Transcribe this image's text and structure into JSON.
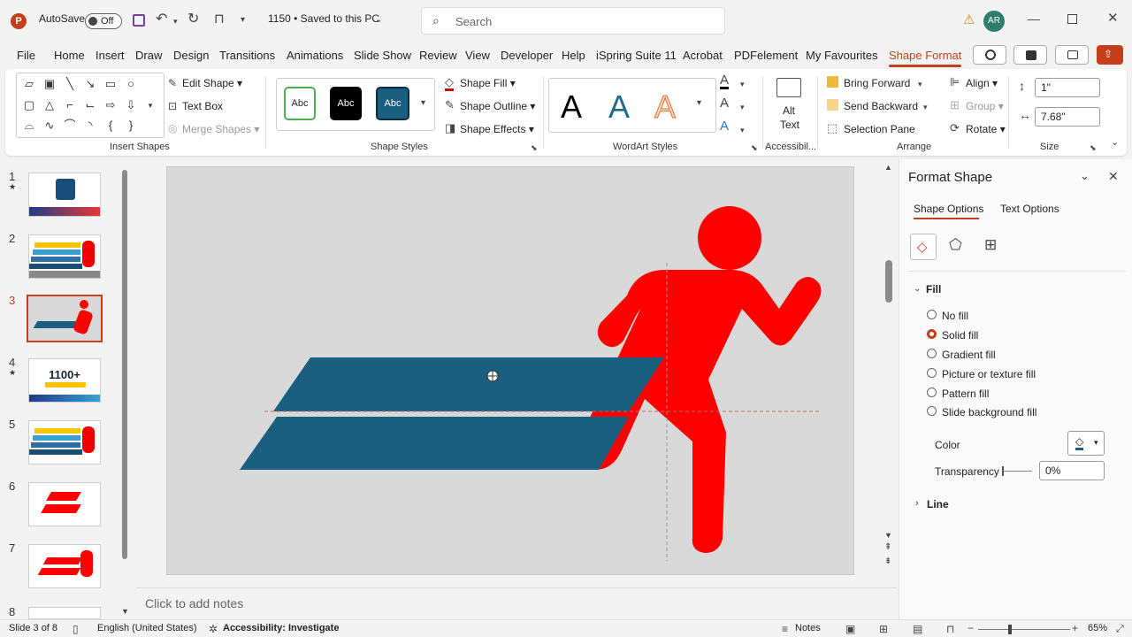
{
  "titlebar": {
    "app_icon_letter": "P",
    "autosave_label": "AutoSave",
    "autosave_state": "Off",
    "doc_title": "1150 • Saved to this PC",
    "search_placeholder": "Search",
    "avatar_initials": "AR"
  },
  "menu": {
    "tabs": [
      "File",
      "Home",
      "Insert",
      "Draw",
      "Design",
      "Transitions",
      "Animations",
      "Slide Show",
      "Review",
      "View",
      "Developer",
      "Help",
      "iSpring Suite 11",
      "Acrobat",
      "PDFelement",
      "My Favourites",
      "Shape Format"
    ],
    "active_tab": "Shape Format"
  },
  "ribbon": {
    "insert_shapes": {
      "group_label": "Insert Shapes",
      "edit_shape": "Edit Shape",
      "text_box": "Text Box",
      "merge_shapes": "Merge Shapes"
    },
    "shape_styles": {
      "group_label": "Shape Styles",
      "swatch_text": "Abc",
      "shape_fill": "Shape Fill",
      "shape_outline": "Shape Outline",
      "shape_effects": "Shape Effects"
    },
    "wordart": {
      "group_label": "WordArt Styles",
      "letter": "A"
    },
    "accessibility": {
      "group_label": "Accessibil...",
      "alt_text_line1": "Alt",
      "alt_text_line2": "Text"
    },
    "arrange": {
      "group_label": "Arrange",
      "bring_forward": "Bring Forward",
      "send_backward": "Send Backward",
      "selection_pane": "Selection Pane",
      "align": "Align",
      "group": "Group",
      "rotate": "Rotate"
    },
    "size": {
      "group_label": "Size",
      "height": "1\"",
      "width": "7.68\""
    }
  },
  "thumbnails": {
    "numbers": [
      "1",
      "2",
      "3",
      "4",
      "5",
      "6",
      "7",
      "8"
    ],
    "slide4_text": "1100+"
  },
  "notes_placeholder": "Click to add notes",
  "format_pane": {
    "title": "Format Shape",
    "tab_shape_options": "Shape Options",
    "tab_text_options": "Text Options",
    "fill_header": "Fill",
    "fill_options": [
      "No fill",
      "Solid fill",
      "Gradient fill",
      "Picture or texture fill",
      "Pattern fill",
      "Slide background fill"
    ],
    "selected_fill": "Solid fill",
    "color_label": "Color",
    "transparency_label": "Transparency",
    "transparency_value": "0%",
    "line_header": "Line"
  },
  "status": {
    "slide_counter": "Slide 3 of 8",
    "language": "English (United States)",
    "accessibility": "Accessibility: Investigate",
    "notes": "Notes",
    "zoom": "65%"
  },
  "colors": {
    "accent": "#c43e1c",
    "runner_red": "#ff0000",
    "parallelogram_blue": "#1a5e80",
    "slide_bg": "#d9d9d9"
  }
}
